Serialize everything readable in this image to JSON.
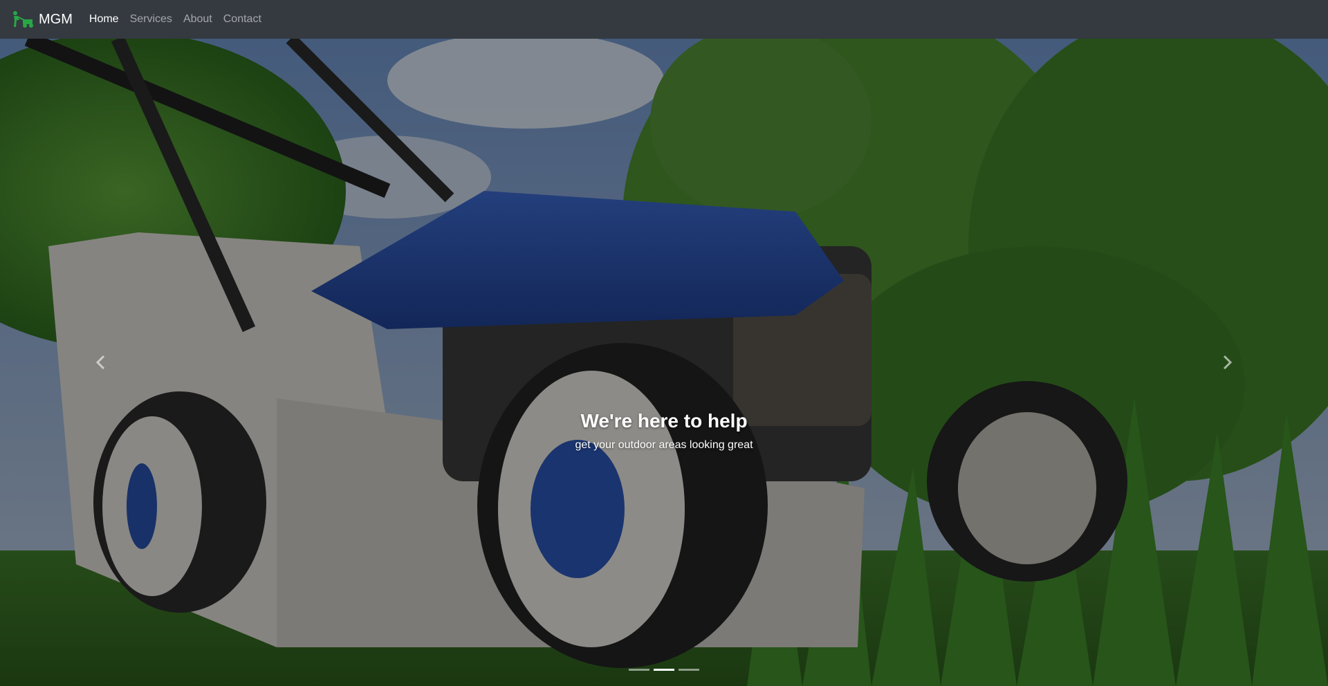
{
  "brand": {
    "name": "MGM",
    "icon": "mower-logo-icon",
    "icon_color": "#28a745"
  },
  "nav": {
    "home": "Home",
    "services": "Services",
    "about": "About",
    "contact": "Contact"
  },
  "carousel": {
    "slide_title": "We're here to help",
    "slide_subtitle": "get your outdoor areas looking great",
    "prev_icon": "chevron-left-icon",
    "next_icon": "chevron-right-icon",
    "slide_count": 3,
    "active_slide": 2
  },
  "colors": {
    "navbar_bg": "#343a40",
    "nav_active": "#ffffff",
    "accent": "#28a745"
  }
}
